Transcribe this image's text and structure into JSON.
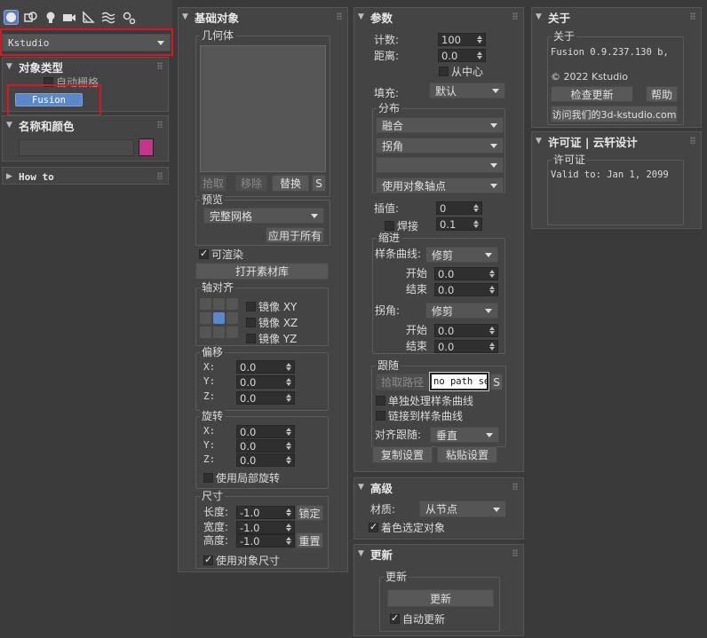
{
  "toolbar": {
    "icons": [
      "sphere-icon",
      "shapes-icon",
      "light-icon",
      "camera-icon",
      "helpers-icon",
      "spacewarps-icon",
      "systems-icon"
    ]
  },
  "left": {
    "dropdown": "Kstudio",
    "object_type": {
      "title": "对象类型",
      "autogrid": "自动栅格",
      "fusion": "Fusion"
    },
    "name_color": {
      "title": "名称和颜色",
      "color": "#c8338a"
    },
    "howto": {
      "title": "How to"
    }
  },
  "base": {
    "title": "基础对象",
    "geometry": "几何体",
    "pick": "拾取",
    "remove": "移除",
    "replace": "替换",
    "s": "S",
    "preview": {
      "label": "预览",
      "mode": "完整网格",
      "apply_all": "应用于所有"
    },
    "renderable": "可渲染",
    "open_lib": "打开素材库",
    "axis": {
      "label": "轴对齐",
      "mirror_xy": "镜像 XY",
      "mirror_xz": "镜像 XZ",
      "mirror_yz": "镜像 YZ"
    },
    "offset": {
      "label": "偏移",
      "x": "X:",
      "y": "Y:",
      "z": "Z:",
      "xv": "0.0",
      "yv": "0.0",
      "zv": "0.0"
    },
    "rotation": {
      "label": "旋转",
      "x": "X:",
      "y": "Y:",
      "z": "Z:",
      "xv": "0.0",
      "yv": "0.0",
      "zv": "0.0",
      "local": "使用局部旋转"
    },
    "size": {
      "label": "尺寸",
      "length": "长度:",
      "width": "宽度:",
      "height": "高度:",
      "lv": "-1.0",
      "wv": "-1.0",
      "hv": "-1.0",
      "lock": "锁定",
      "reset": "重置",
      "use_obj": "使用对象尺寸"
    }
  },
  "params": {
    "title": "参数",
    "count": "计数:",
    "count_v": "100",
    "distance": "距离:",
    "distance_v": "0.0",
    "from_center": "从中心",
    "fill": "填充:",
    "fill_v": "默认",
    "dist": {
      "label": "分布",
      "d1": "融合",
      "d2": "拐角",
      "d3": "",
      "d4": "使用对象轴点"
    },
    "interp": "插值:",
    "interp_v": "0",
    "weld": "焊接",
    "weld_v": "0.1",
    "indent": {
      "label": "缩进",
      "spline": "样条曲线:",
      "spline_v": "修剪",
      "start": "开始",
      "start_v": "0.0",
      "end": "结束",
      "end_v": "0.0",
      "corner": "拐角:",
      "corner_v": "修剪",
      "start2": "开始",
      "start2_v": "0.0",
      "end2": "结束",
      "end2_v": "0.0"
    },
    "follow": {
      "label": "跟随",
      "pick_path": "拾取路径",
      "path": "no path se",
      "s": "S",
      "each_spline": "单独处理样条曲线",
      "link_spline": "链接到样条曲线",
      "align": "对齐跟随:",
      "align_v": "垂直"
    },
    "copy": "复制设置",
    "paste": "粘贴设置"
  },
  "advanced": {
    "title": "高级",
    "material": "材质:",
    "material_v": "从节点",
    "color_sel": "着色选定对象"
  },
  "update": {
    "title": "更新",
    "group": "更新",
    "btn": "更新",
    "auto": "自动更新"
  },
  "about": {
    "title": "关于",
    "group": "关于",
    "version": "Fusion 0.9.237.130 b,",
    "copyright": "© 2022 Kstudio",
    "check": "检查更新",
    "help": "帮助",
    "visit": "访问我们的3d-kstudio.com"
  },
  "license": {
    "title": "许可证 | 云轩设计",
    "group": "许可证",
    "valid": "Valid to: Jan 1, 2099"
  }
}
